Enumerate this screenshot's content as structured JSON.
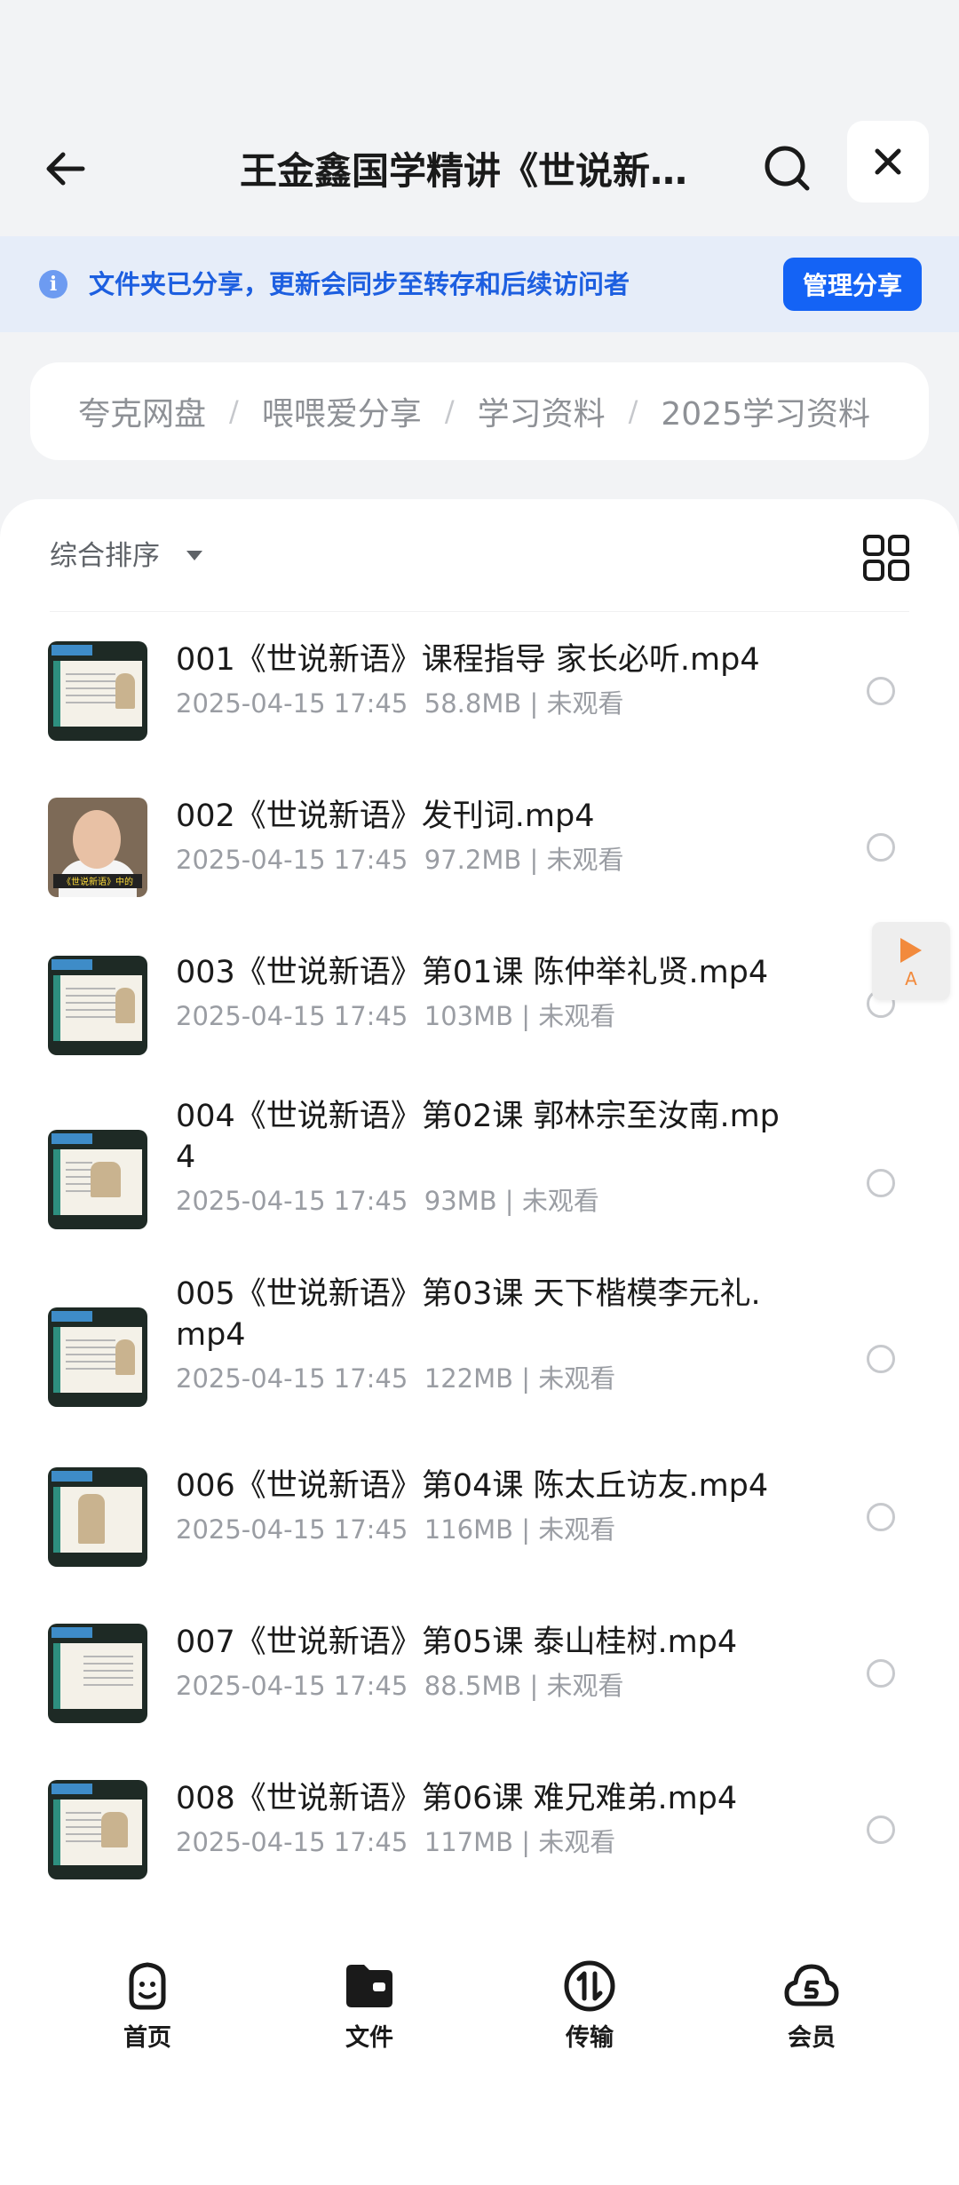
{
  "header": {
    "title": "王金鑫国学精讲《世说新语》"
  },
  "banner": {
    "text": "文件夹已分享，更新会同步至转存和后续访问者",
    "button": "管理分享"
  },
  "breadcrumb": [
    "夸克网盘",
    "喂喂爱分享",
    "学习资料",
    "2025学习资料"
  ],
  "sort": {
    "label": "综合排序"
  },
  "files": [
    {
      "name": "001《世说新语》课程指导 家长必听.mp4",
      "date": "2025-04-15 17:45",
      "size": "58.8MB",
      "status": "未观看"
    },
    {
      "name": "002《世说新语》发刊词.mp4",
      "date": "2025-04-15 17:45",
      "size": "97.2MB",
      "status": "未观看"
    },
    {
      "name": "003《世说新语》第01课 陈仲举礼贤.mp4",
      "date": "2025-04-15 17:45",
      "size": "103MB",
      "status": "未观看"
    },
    {
      "name": "004《世说新语》第02课 郭林宗至汝南.mp4",
      "date": "2025-04-15 17:45",
      "size": "93MB",
      "status": "未观看"
    },
    {
      "name": "005《世说新语》第03课 天下楷模李元礼.mp4",
      "date": "2025-04-15 17:45",
      "size": "122MB",
      "status": "未观看"
    },
    {
      "name": "006《世说新语》第04课 陈太丘访友.mp4",
      "date": "2025-04-15 17:45",
      "size": "116MB",
      "status": "未观看"
    },
    {
      "name": "007《世说新语》第05课 泰山桂树.mp4",
      "date": "2025-04-15 17:45",
      "size": "88.5MB",
      "status": "未观看"
    },
    {
      "name": "008《世说新语》第06课 难兄难弟.mp4",
      "date": "2025-04-15 17:45",
      "size": "117MB",
      "status": "未观看"
    }
  ],
  "float_player": {
    "label": "A"
  },
  "nav": [
    {
      "label": "首页",
      "icon": "home-face-icon"
    },
    {
      "label": "文件",
      "icon": "folder-icon"
    },
    {
      "label": "传输",
      "icon": "transfer-icon"
    },
    {
      "label": "会员",
      "icon": "cloud-vip-icon"
    }
  ],
  "colors": {
    "accent": "#1463f5",
    "banner_bg": "#e6edf9",
    "banner_text": "#1d5fe0"
  }
}
